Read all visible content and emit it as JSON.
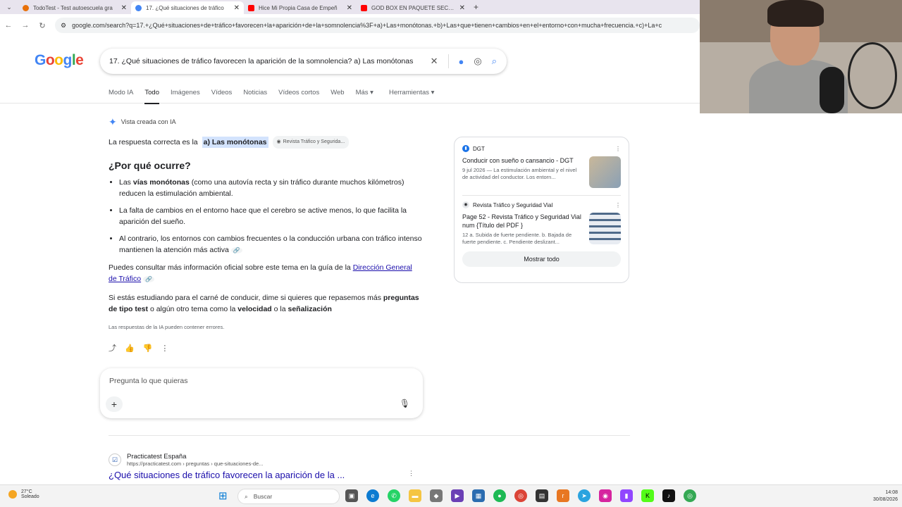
{
  "browser": {
    "tabs": [
      {
        "title": "TodoTest - Test autoescuela gra",
        "icon_color": "#e8710a",
        "active": false
      },
      {
        "title": "17. ¿Qué situaciones de tráfico",
        "icon_color": "#4285f4",
        "active": true
      },
      {
        "title": "Hice Mi Propia Casa de Empeñ",
        "icon_color": "#ff0000",
        "active": false
      },
      {
        "title": "GOD BOX EN PAQUETE SECRET",
        "icon_color": "#ff0000",
        "active": false
      }
    ],
    "new_tab": "+",
    "close_glyph": "✕",
    "url": "google.com/search?q=17.+¿Qué+situaciones+de+tráfico+favorecen+la+aparición+de+la+somnolencia%3F+a)+Las+monótonas.+b)+Las+que+tienen+cambios+en+el+entorno+con+mucha+frecuencia.+c)+La+c"
  },
  "google": {
    "logo": "Google",
    "query": "17. ¿Qué situaciones de tráfico favorecen la aparición de la somnolencia? a) Las monótonas",
    "tabs": [
      "Modo IA",
      "Todo",
      "Imágenes",
      "Vídeos",
      "Noticias",
      "Vídeos cortos",
      "Web",
      "Más",
      "Herramientas"
    ],
    "active_tab": "Todo"
  },
  "ai": {
    "badge": "Vista creada con IA",
    "answer_prefix": "La respuesta correcta es la",
    "answer_highlight": "a) Las monótonas",
    "answer_source": "Revista Tráfico y Segurida...",
    "heading": "¿Por qué ocurre?",
    "bullet1_pre": "Las",
    "bullet1_bold": "vías monótonas",
    "bullet1_post": "(como una autovía recta y sin tráfico durante muchos kilómetros) reducen la estimulación ambiental.",
    "bullet2": "La falta de cambios en el entorno hace que el cerebro se active menos, lo que facilita la aparición del sueño.",
    "bullet3": "Al contrario, los entornos con cambios frecuentes o la conducción urbana con tráfico intenso mantienen la atención más activa",
    "para1_pre": "Puedes consultar más información oficial sobre este tema en la guía de la",
    "para1_link": "Dirección General de Tráfico",
    "para2_pre": "Si estás estudiando para el carné de conducir, dime si quieres que repasemos más",
    "para2_b1": "preguntas de tipo test",
    "para2_mid": "o algún otro tema como la",
    "para2_b2": "velocidad",
    "para2_and": "o la",
    "para2_b3": "señalización",
    "disclaimer": "Las respuestas de la IA pueden contener errores.",
    "ask_placeholder": "Pregunta lo que quieras"
  },
  "sources_card": {
    "items": [
      {
        "source": "DGT",
        "title": "Conducir con sueño o cansancio - DGT",
        "snippet": "9 jul 2026 — La estimulación ambiental y el nivel de actividad del conductor. Los entorn..."
      },
      {
        "source": "Revista Tráfico y Seguridad Vial",
        "title": "Page 52 - Revista Tráfico y Seguridad Vial num {Título del PDF }",
        "snippet": "12 a. Subida de fuerte pendiente. b. Bajada de fuerte pendiente. c. Pendiente deslizant..."
      }
    ],
    "show_all": "Mostrar todo"
  },
  "result": {
    "site": "Practicatest España",
    "url": "https://practicatest.com › preguntas › que-situaciones-de...",
    "title": "¿Qué situaciones de tráfico favorecen la aparición de la ..."
  },
  "taskbar": {
    "temp": "27°C",
    "weather": "Soleado",
    "search": "Buscar",
    "time": "14:08",
    "date": "30/08/2026"
  }
}
